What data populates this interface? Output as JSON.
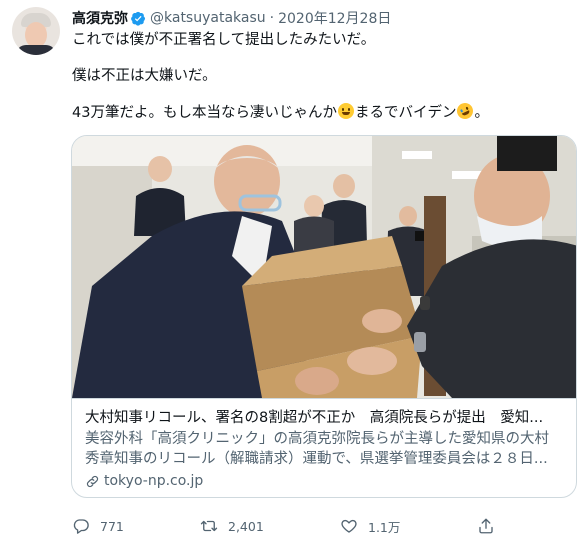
{
  "tweet": {
    "author_name": "高須克弥",
    "author_handle": "@katsuyatakasu",
    "separator": "·",
    "date": "2020年12月28日",
    "line1": "これでは僕が不正署名して提出したみたいだ。",
    "line2": "僕は不正は大嫌いだ。",
    "line3_a": "43万筆だよ。もし本当なら凄いじゃんか",
    "line3_b": "まるでバイデン",
    "line3_c": "。"
  },
  "card": {
    "title": "大村知事リコール、署名の8割超が不正か　高須院長らが提出　愛知...",
    "desc_line1": "美容外科「高須クリニック」の高須克弥院長らが主導した愛知県の大村",
    "desc_line2": "秀章知事のリコール（解職請求）運動で、県選挙管理委員会は２８日...",
    "domain": "tokyo-np.co.jp"
  },
  "actions": {
    "reply_count": "771",
    "retweet_count": "2,401",
    "like_count": "1.1万"
  },
  "colors": {
    "text": "#0f1419",
    "secondary": "#536471",
    "verified": "#1d9bf0",
    "border": "#cfd9de"
  },
  "icons": [
    "verified-badge-icon",
    "grinning-emoji",
    "rofl-emoji",
    "link-icon",
    "reply-icon",
    "retweet-icon",
    "like-icon",
    "share-icon"
  ]
}
